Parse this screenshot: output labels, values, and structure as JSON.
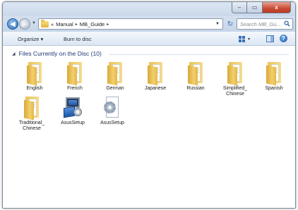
{
  "window": {
    "caption": {
      "minimize": "–",
      "maximize": "▭",
      "close": "x"
    }
  },
  "address": {
    "overflow": "«",
    "crumbs": [
      "Manual",
      "MB_Guide"
    ],
    "separator": "▸"
  },
  "search": {
    "placeholder": "Search MB_Gu..."
  },
  "toolbar": {
    "organize_label": "Organize ▾",
    "burn_label": "Burn to disc",
    "views_dropdown": "▾"
  },
  "content": {
    "group_header": "Files Currently on the Disc (10)",
    "items": [
      {
        "label": "English",
        "icon": "folder-icon"
      },
      {
        "label": "French",
        "icon": "folder-icon"
      },
      {
        "label": "German",
        "icon": "folder-icon"
      },
      {
        "label": "Japanese",
        "icon": "folder-icon"
      },
      {
        "label": "Russian",
        "icon": "folder-icon"
      },
      {
        "label": "Simplified_\nChinese",
        "icon": "folder-icon"
      },
      {
        "label": "Spanish",
        "icon": "folder-icon"
      },
      {
        "label": "Traditional_\nChinese",
        "icon": "folder-icon"
      },
      {
        "label": "AsusSetup",
        "icon": "setup-application-icon"
      },
      {
        "label": "AsusSetup",
        "icon": "setup-config-icon"
      }
    ]
  }
}
